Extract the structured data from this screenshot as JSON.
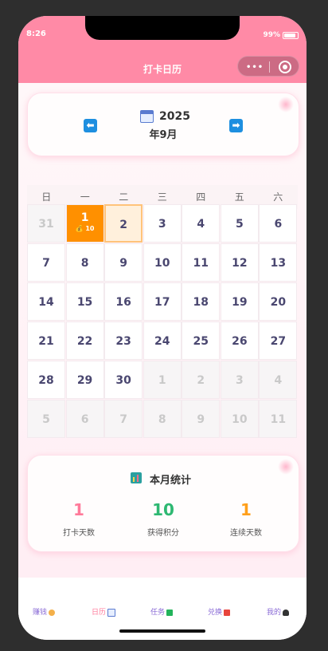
{
  "status": {
    "time": "8:26",
    "battery": "99%"
  },
  "nav": {
    "title": "打卡日历",
    "more": "•••"
  },
  "header": {
    "year": "2025",
    "month": "年9月",
    "prev": "⬅",
    "next": "➡"
  },
  "weekdays": [
    "日",
    "一",
    "二",
    "三",
    "四",
    "五",
    "六"
  ],
  "calendar": {
    "days": [
      "31",
      "1",
      "2",
      "3",
      "4",
      "5",
      "6",
      "7",
      "8",
      "9",
      "10",
      "11",
      "12",
      "13",
      "14",
      "15",
      "16",
      "17",
      "18",
      "19",
      "20",
      "21",
      "22",
      "23",
      "24",
      "25",
      "26",
      "27",
      "28",
      "29",
      "30",
      "1",
      "2",
      "3",
      "4",
      "5",
      "6",
      "7",
      "8",
      "9",
      "10",
      "11"
    ],
    "checked_points": "💰 10"
  },
  "stats": {
    "title": "本月统计",
    "items": [
      {
        "value": "1",
        "label": "打卡天数",
        "color": "#ff7a9a"
      },
      {
        "value": "10",
        "label": "获得积分",
        "color": "#2eb872"
      },
      {
        "value": "1",
        "label": "连续天数",
        "color": "#ff9f1a"
      }
    ]
  },
  "tabs": [
    {
      "label": "赚钱",
      "icon": "money-bag-icon",
      "color": "#8a6bd6",
      "active": false
    },
    {
      "label": "日历",
      "icon": "calendar-icon",
      "color": "#ff7a9a",
      "active": true
    },
    {
      "label": "任务",
      "icon": "check-box-icon",
      "color": "#8a6bd6",
      "active": false
    },
    {
      "label": "兑换",
      "icon": "gift-icon",
      "color": "#8a6bd6",
      "active": false
    },
    {
      "label": "我的",
      "icon": "user-icon",
      "color": "#8a6bd6",
      "active": false
    }
  ]
}
